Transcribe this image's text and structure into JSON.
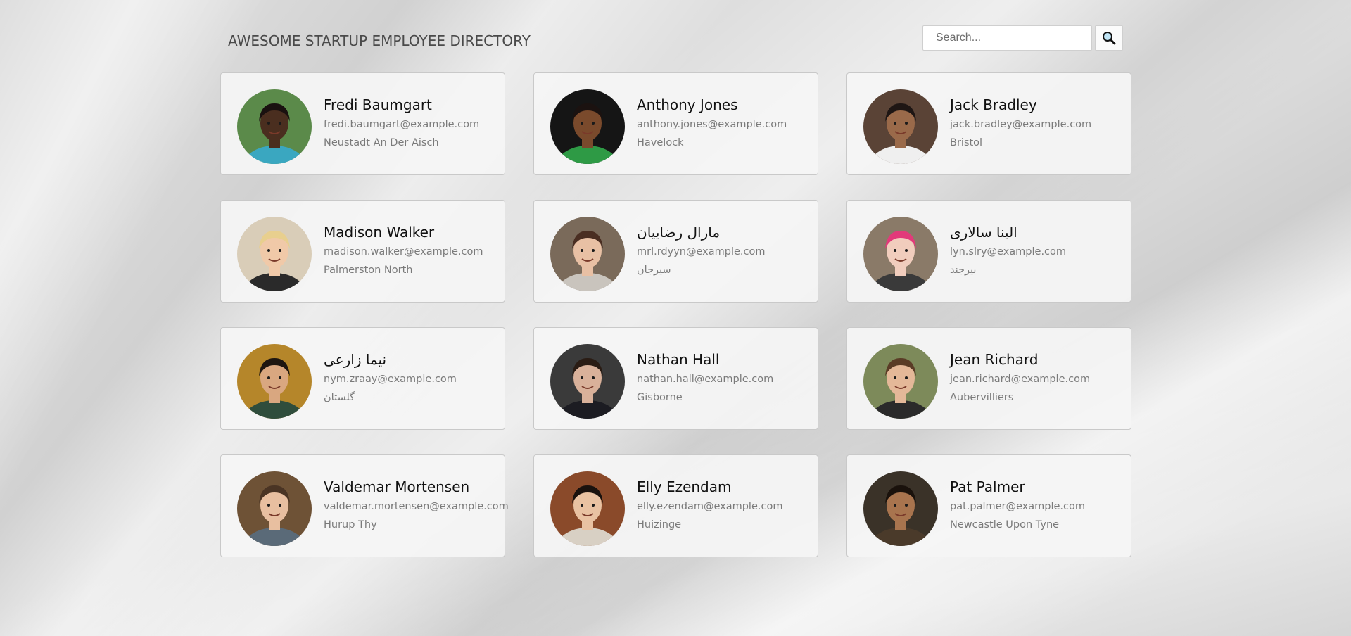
{
  "header": {
    "title": "AWESOME STARTUP EMPLOYEE DIRECTORY",
    "search_placeholder": "Search...",
    "search_icon": "magnifier-icon"
  },
  "employees": [
    {
      "name": "Fredi Baumgart",
      "email": "fredi.baumgart@example.com",
      "city": "Neustadt An Der Aisch",
      "avatar": {
        "bg": "#5b8a4a",
        "skin": "#4a2e1f",
        "hair": "#1a1110",
        "shirt": "#3aa7c0"
      }
    },
    {
      "name": "Anthony Jones",
      "email": "anthony.jones@example.com",
      "city": "Havelock",
      "avatar": {
        "bg": "#151515",
        "skin": "#7a4a2c",
        "hair": "#1b1210",
        "shirt": "#2e9a45"
      }
    },
    {
      "name": "Jack Bradley",
      "email": "jack.bradley@example.com",
      "city": "Bristol",
      "avatar": {
        "bg": "#5a4336",
        "skin": "#9a6a4a",
        "hair": "#1e1614",
        "shirt": "#efefef"
      }
    },
    {
      "name": "Madison Walker",
      "email": "madison.walker@example.com",
      "city": "Palmerston North",
      "avatar": {
        "bg": "#d9cdb8",
        "skin": "#f0c9a8",
        "hair": "#e8cf8e",
        "shirt": "#2a2a2a"
      }
    },
    {
      "name": "مارال رضاییان",
      "email": "mrl.rdyyn@example.com",
      "city": "سیرجان",
      "avatar": {
        "bg": "#7a6a5a",
        "skin": "#e8c0a4",
        "hair": "#4a2e22",
        "shirt": "#c9c4bd"
      }
    },
    {
      "name": "الینا سالاری",
      "email": "lyn.slry@example.com",
      "city": "بیرجند",
      "avatar": {
        "bg": "#8a7a68",
        "skin": "#f1cdbd",
        "hair": "#e23a7a",
        "shirt": "#3a3a3a"
      }
    },
    {
      "name": "نیما زارعی",
      "email": "nym.zraay@example.com",
      "city": "گلستان",
      "avatar": {
        "bg": "#b5862a",
        "skin": "#d9a780",
        "hair": "#1e1610",
        "shirt": "#2f4d3c"
      }
    },
    {
      "name": "Nathan Hall",
      "email": "nathan.hall@example.com",
      "city": "Gisborne",
      "avatar": {
        "bg": "#3a3a3a",
        "skin": "#d9b19a",
        "hair": "#2a1c14",
        "shirt": "#1c1c22"
      }
    },
    {
      "name": "Jean Richard",
      "email": "jean.richard@example.com",
      "city": "Aubervilliers",
      "avatar": {
        "bg": "#7d8a5a",
        "skin": "#e4b898",
        "hair": "#5a3c26",
        "shirt": "#2a2a2a"
      }
    },
    {
      "name": "Valdemar Mortensen",
      "email": "valdemar.mortensen@example.com",
      "city": "Hurup Thy",
      "avatar": {
        "bg": "#6e5236",
        "skin": "#e8bfa0",
        "hair": "#4a3424",
        "shirt": "#5a6a78"
      }
    },
    {
      "name": "Elly Ezendam",
      "email": "elly.ezendam@example.com",
      "city": "Huizinge",
      "avatar": {
        "bg": "#8a4a2a",
        "skin": "#e9c2a2",
        "hair": "#1a120e",
        "shirt": "#d8d0c4"
      }
    },
    {
      "name": "Pat Palmer",
      "email": "pat.palmer@example.com",
      "city": "Newcastle Upon Tyne",
      "avatar": {
        "bg": "#3a3228",
        "skin": "#a8744e",
        "hair": "#1a120c",
        "shirt": "#4a3a2a"
      }
    }
  ]
}
